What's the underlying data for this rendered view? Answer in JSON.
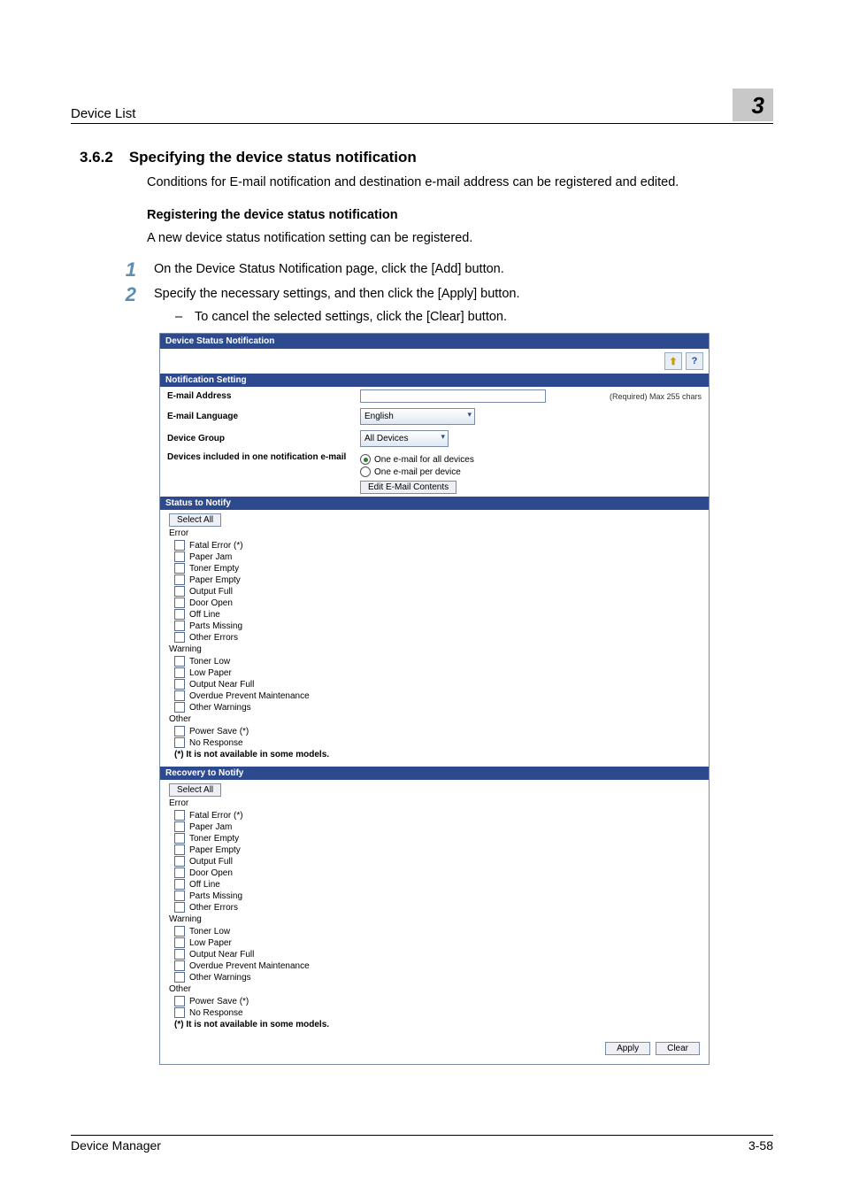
{
  "header": {
    "title": "Device List",
    "chapter": "3"
  },
  "section": {
    "number": "3.6.2",
    "title": "Specifying the device status notification"
  },
  "intro": "Conditions for E-mail notification and destination e-mail address can be registered and edited.",
  "subhead": "Registering the device status notification",
  "subintro": "A new device status notification setting can be registered.",
  "steps": [
    {
      "n": "1",
      "text": "On the Device Status Notification page, click the [Add] button."
    },
    {
      "n": "2",
      "text": "Specify the necessary settings, and then click the [Apply] button."
    }
  ],
  "bullet_dash": "–",
  "bullet": "To cancel the selected settings, click the [Clear] button.",
  "shot": {
    "window_title": "Device Status Notification",
    "icons": {
      "up": "⬆",
      "help": "?"
    },
    "sec_notification": "Notification Setting",
    "rows": {
      "email_addr_label": "E-mail Address",
      "required_note": "(Required) Max 255 chars",
      "email_lang_label": "E-mail Language",
      "email_lang_value": "English",
      "device_group_label": "Device Group",
      "device_group_value": "All Devices",
      "devices_included_label": "Devices included in one notification e-mail",
      "radio1": "One e-mail for all devices",
      "radio2": "One e-mail per device",
      "edit_btn": "Edit E-Mail Contents"
    },
    "sec_status": "Status to Notify",
    "sec_recovery": "Recovery to Notify",
    "select_all": "Select All",
    "group_error": "Error",
    "group_warning": "Warning",
    "group_other": "Other",
    "error_items": [
      "Fatal Error (*)",
      "Paper Jam",
      "Toner Empty",
      "Paper Empty",
      "Output Full",
      "Door Open",
      "Off Line",
      "Parts Missing",
      "Other Errors"
    ],
    "warning_items": [
      "Toner Low",
      "Low Paper",
      "Output Near Full",
      "Overdue Prevent Maintenance",
      "Other Warnings"
    ],
    "other_items": [
      "Power Save (*)",
      "No Response"
    ],
    "note": "(*) It is not available in some models.",
    "apply_btn": "Apply",
    "clear_btn": "Clear"
  },
  "footer": {
    "left": "Device Manager",
    "right": "3-58"
  }
}
